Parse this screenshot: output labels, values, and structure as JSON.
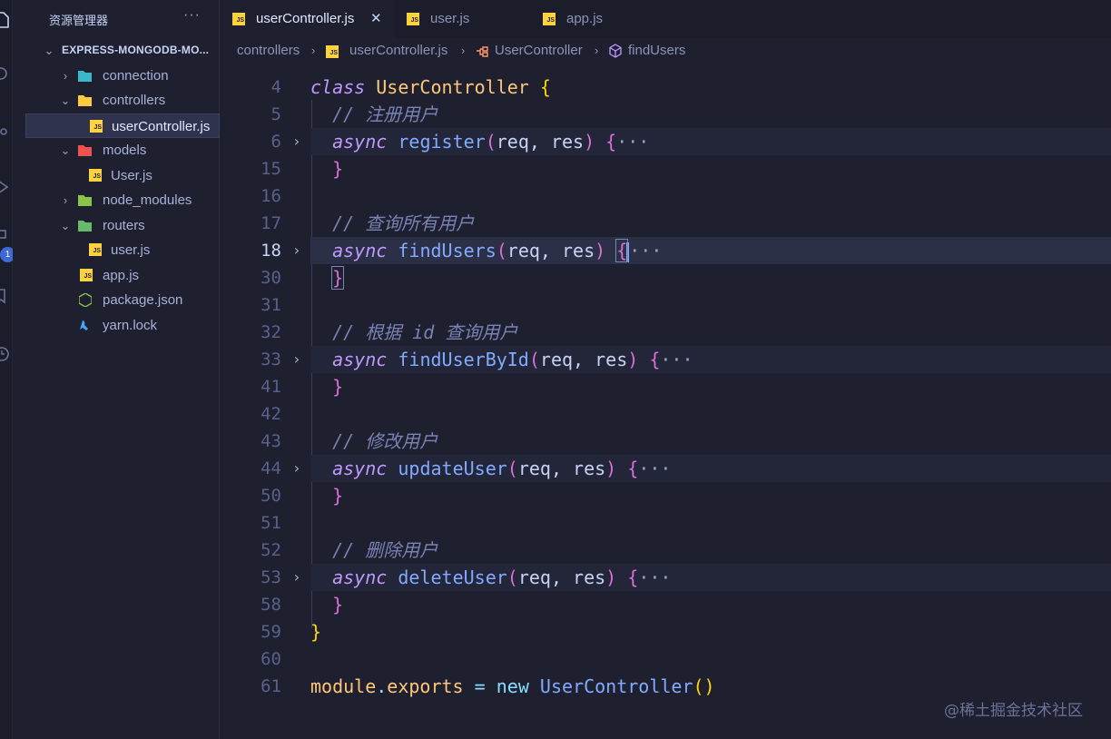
{
  "explorer": {
    "title": "资源管理器",
    "more": "···",
    "project": "EXPRESS-MONGODB-MO...",
    "items": [
      {
        "label": "connection"
      },
      {
        "label": "controllers"
      },
      {
        "label": "userController.js"
      },
      {
        "label": "models"
      },
      {
        "label": "User.js"
      },
      {
        "label": "node_modules"
      },
      {
        "label": "routers"
      },
      {
        "label": "user.js"
      },
      {
        "label": "app.js"
      },
      {
        "label": "package.json"
      },
      {
        "label": "yarn.lock"
      }
    ],
    "js_badge": "JS",
    "badge_count": "1"
  },
  "tabs": [
    {
      "label": "userController.js",
      "close": "✕"
    },
    {
      "label": "user.js"
    },
    {
      "label": "app.js"
    }
  ],
  "breadcrumb": {
    "folder": "controllers",
    "file": "userController.js",
    "class": "UserController",
    "method": "findUsers"
  },
  "editor": {
    "line_numbers": [
      "4",
      "5",
      "6",
      "15",
      "16",
      "17",
      "18",
      "30",
      "31",
      "32",
      "33",
      "41",
      "42",
      "43",
      "44",
      "50",
      "51",
      "52",
      "53",
      "58",
      "59",
      "60",
      "61"
    ],
    "comments": {
      "c5": "// 注册用户",
      "c17": "// 查询所有用户",
      "c32": "// 根据 id 查询用户",
      "c43": "// 修改用户",
      "c52": "// 删除用户"
    },
    "tokens": {
      "class_kw": "class",
      "class_name": "UserController",
      "open_brace": "{",
      "close_brace": "}",
      "async": "async",
      "fn_register": "register",
      "fn_findUsers": "findUsers",
      "fn_findUserById": "findUserById",
      "fn_updateUser": "updateUser",
      "fn_deleteUser": "deleteUser",
      "lparen": "(",
      "rparen": ")",
      "req": "req",
      "comma": ",",
      "res": "res",
      "ellipsis": "···",
      "module": "module",
      "dot": ".",
      "exports": "exports",
      "eq": "=",
      "new": "new",
      "call_parens": "()"
    }
  },
  "watermark": "@稀土掘金技术社区"
}
